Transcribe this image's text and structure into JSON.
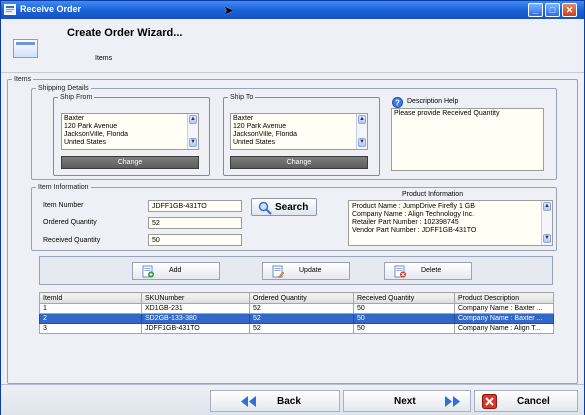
{
  "window": {
    "title": "Receive Order"
  },
  "header": {
    "title": "Create Order Wizard...",
    "subtitle": "Items"
  },
  "items_group": {
    "label": "Items"
  },
  "shipping": {
    "label": "Shipping Details",
    "ship_from": {
      "label": "Ship From",
      "lines": [
        "Baxter",
        "120 Park Avenue",
        "JacksonVille, Florida",
        "United States"
      ],
      "button": "Change"
    },
    "ship_to": {
      "label": "Ship To",
      "lines": [
        "Baxter",
        "120 Park Avenue",
        "JacksonVille, Florida",
        "United States"
      ],
      "button": "Change"
    },
    "help": {
      "label": "Description Help",
      "text": "Please provide Received Quantity"
    }
  },
  "item_info": {
    "label": "Item Information",
    "item_number": {
      "label": "Item Number",
      "value": "JDFF1GB-431TO"
    },
    "ordered_quantity": {
      "label": "Ordered Quantity",
      "value": "52"
    },
    "received_quantity": {
      "label": "Received Quantity",
      "value": "50"
    },
    "search_button": "Search",
    "product_info": {
      "label": "Product Information",
      "lines": [
        "Product Name : JumpDrive Firefly 1 GB",
        "Company Name : Align Technology Inc.",
        "Retailer Part Number : 102398745",
        "Vendor Part Number : JDFF1GB-431TO"
      ]
    }
  },
  "actions": {
    "add": "Add",
    "update": "Update",
    "delete": "Delete"
  },
  "table": {
    "columns": [
      "ItemId",
      "SKUNumber",
      "Ordered Quantity",
      "Received Quantity",
      "Product Description"
    ],
    "rows": [
      [
        "1",
        "XD1GB-231",
        "52",
        "50",
        "Company Name : Baxter ..."
      ],
      [
        "2",
        "SD2GB-133-380",
        "52",
        "50",
        "Company Name : Baxter ..."
      ],
      [
        "3",
        "JDFF1GB-431TO",
        "52",
        "50",
        "Company Name : Align T..."
      ]
    ],
    "selected_row": 1
  },
  "footer": {
    "back": "Back",
    "next": "Next",
    "cancel": "Cancel"
  },
  "colors": {
    "titlebar": "#1a5fd6",
    "selection": "#3269c8",
    "input_bg": "#fffff5"
  },
  "icons": [
    "app-icon",
    "minimize-icon",
    "maximize-icon",
    "close-icon",
    "wizard-icon",
    "help-icon",
    "search-icon",
    "add-icon",
    "update-icon",
    "delete-icon",
    "back-arrow-icon",
    "next-arrow-icon",
    "cancel-icon"
  ]
}
